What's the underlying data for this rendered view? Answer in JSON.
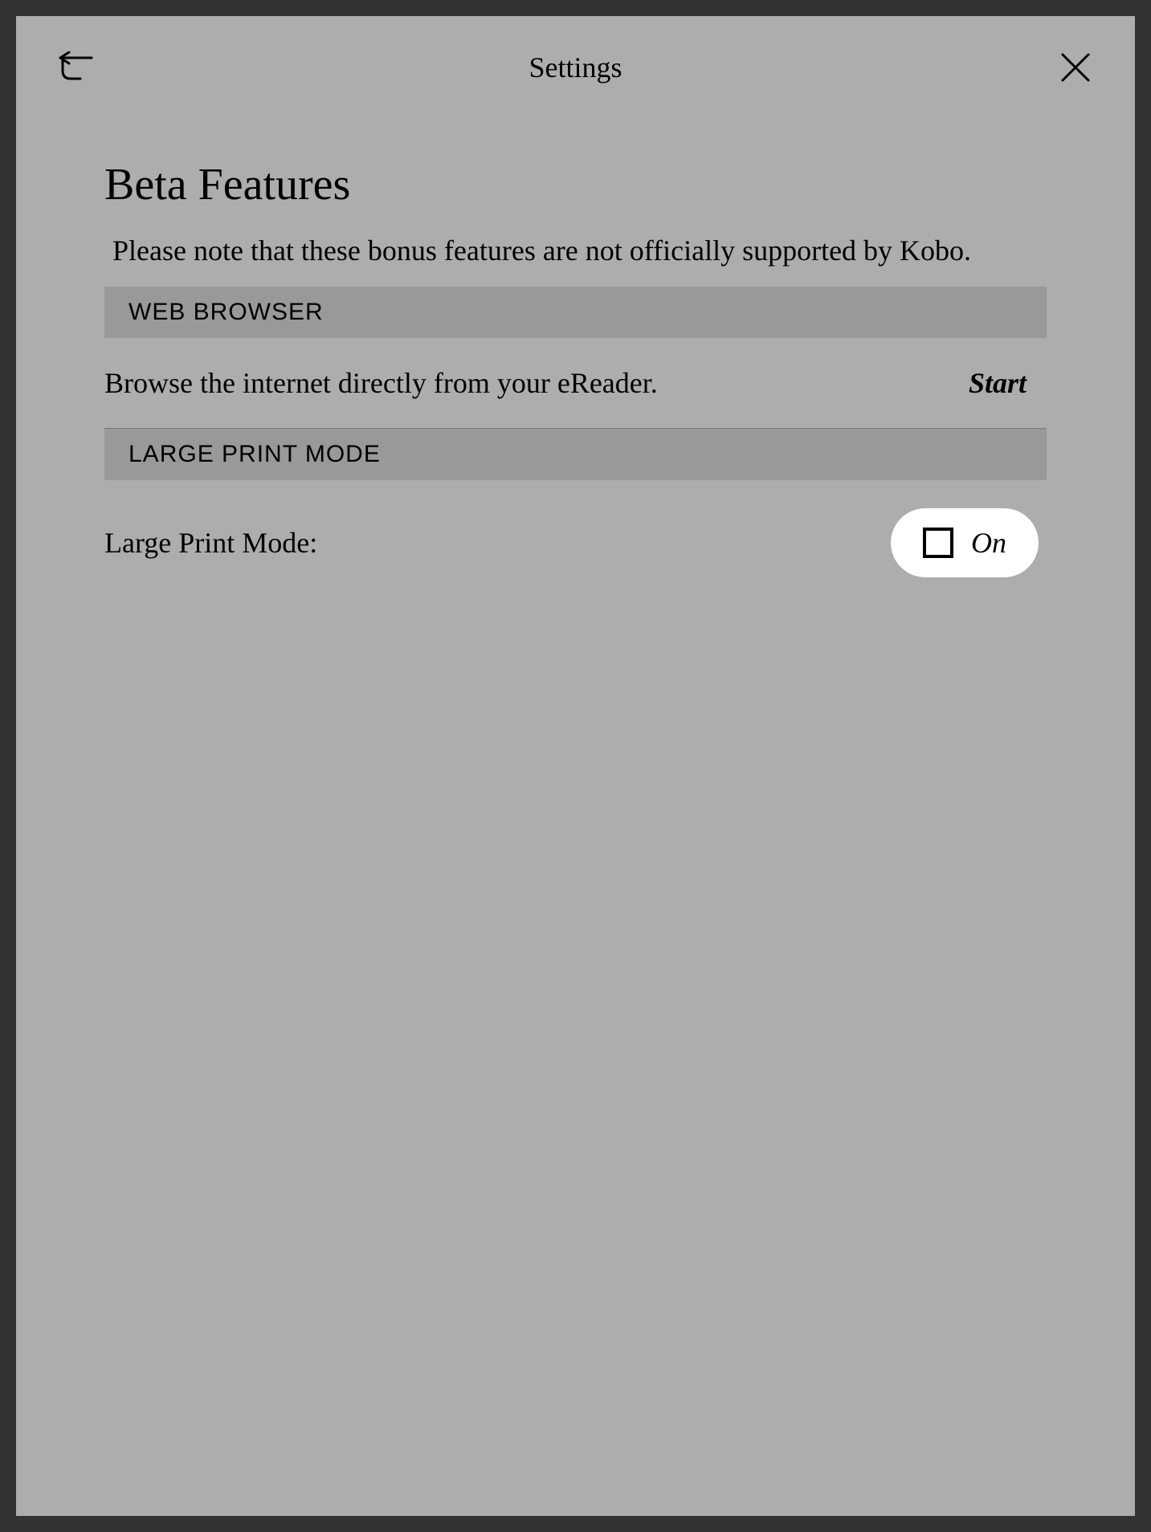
{
  "header": {
    "title": "Settings"
  },
  "page": {
    "heading": "Beta Features",
    "subtitle": "Please note that these bonus features are not officially supported by Kobo."
  },
  "sections": {
    "web_browser": {
      "header": "WEB BROWSER",
      "description": "Browse the internet directly from your eReader.",
      "action_label": "Start"
    },
    "large_print": {
      "header": "LARGE PRINT MODE",
      "label": "Large Print Mode:",
      "toggle_label": "On",
      "toggle_state": "unchecked"
    }
  }
}
